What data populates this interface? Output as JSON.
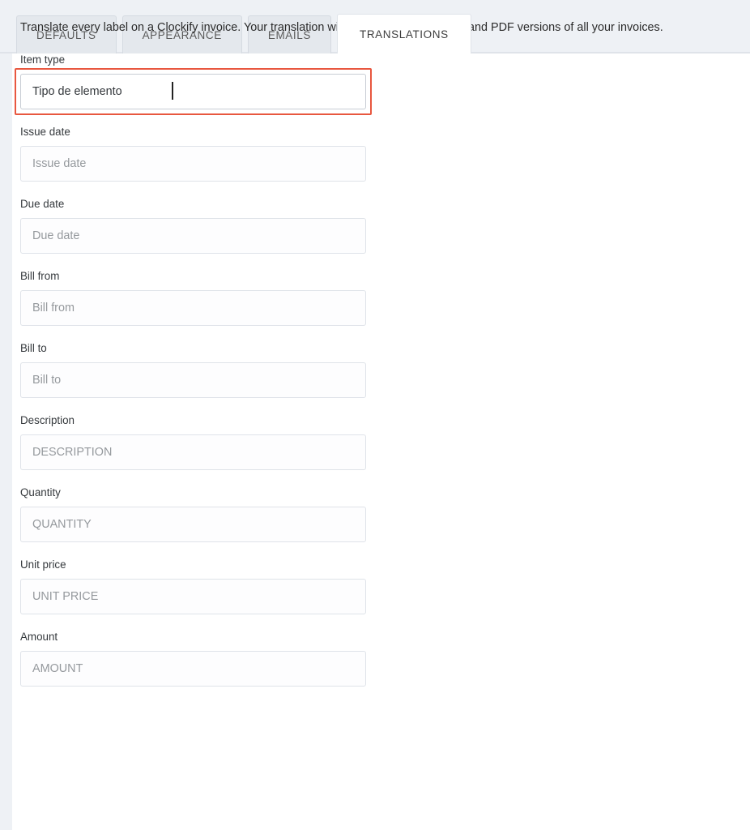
{
  "tabs": [
    {
      "label": "DEFAULTS",
      "active": false
    },
    {
      "label": "APPEARANCE",
      "active": false
    },
    {
      "label": "EMAILS",
      "active": false
    },
    {
      "label": "TRANSLATIONS",
      "active": true
    }
  ],
  "content": {
    "intro": "Translate every label on a Clockify invoice. Your translation will show up on the printed and PDF versions of all your invoices."
  },
  "colors": {
    "highlight": "#e8573f",
    "header_bg": "#eef1f5",
    "panel_bg": "#ffffff",
    "input_border": "#dfe3e9",
    "placeholder": "#95999d"
  },
  "fields": [
    {
      "label": "Item type",
      "value": "Tipo de elemento",
      "placeholder": "Item type",
      "highlighted": true,
      "focused": true
    },
    {
      "label": "Issue date",
      "value": "",
      "placeholder": "Issue date",
      "highlighted": false,
      "focused": false
    },
    {
      "label": "Due date",
      "value": "",
      "placeholder": "Due date",
      "highlighted": false,
      "focused": false
    },
    {
      "label": "Bill from",
      "value": "",
      "placeholder": "Bill from",
      "highlighted": false,
      "focused": false
    },
    {
      "label": "Bill to",
      "value": "",
      "placeholder": "Bill to",
      "highlighted": false,
      "focused": false
    },
    {
      "label": "Description",
      "value": "",
      "placeholder": "DESCRIPTION",
      "highlighted": false,
      "focused": false
    },
    {
      "label": "Quantity",
      "value": "",
      "placeholder": "QUANTITY",
      "highlighted": false,
      "focused": false
    },
    {
      "label": "Unit price",
      "value": "",
      "placeholder": "UNIT PRICE",
      "highlighted": false,
      "focused": false
    },
    {
      "label": "Amount",
      "value": "",
      "placeholder": "AMOUNT",
      "highlighted": false,
      "focused": false
    }
  ]
}
